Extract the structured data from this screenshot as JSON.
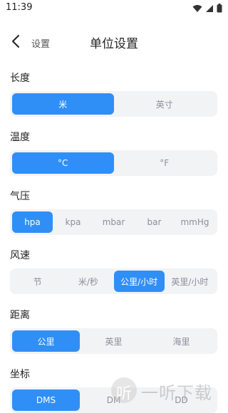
{
  "status": {
    "time": "11:39"
  },
  "header": {
    "back_label": "设置",
    "title": "单位设置"
  },
  "sections": [
    {
      "label": "长度",
      "options": [
        "米",
        "英寸"
      ],
      "selected": 0
    },
    {
      "label": "温度",
      "options": [
        "°C",
        "°F"
      ],
      "selected": 0
    },
    {
      "label": "气压",
      "options": [
        "hpa",
        "kpa",
        "mbar",
        "bar",
        "mmHg"
      ],
      "selected": 0
    },
    {
      "label": "风速",
      "options": [
        "节",
        "米/秒",
        "公里/小时",
        "英里/小时"
      ],
      "selected": 2
    },
    {
      "label": "距离",
      "options": [
        "公里",
        "英里",
        "海里"
      ],
      "selected": 0
    },
    {
      "label": "坐标",
      "options": [
        "DMS",
        "DM",
        "DD"
      ],
      "selected": 0
    }
  ],
  "watermark": {
    "icon_glyph": "听",
    "text": "一听下载"
  },
  "colors": {
    "accent": "#2f8ff7",
    "segment_bg": "#f2f3f5",
    "inactive_text": "#8a8f99"
  }
}
